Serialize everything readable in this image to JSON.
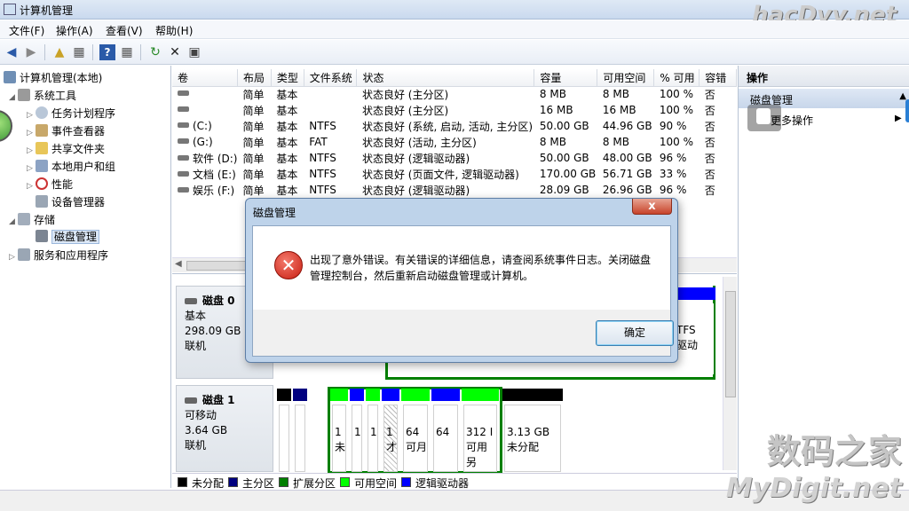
{
  "window": {
    "title": "计算机管理"
  },
  "menu": [
    "文件(F)",
    "操作(A)",
    "查看(V)",
    "帮助(H)"
  ],
  "tree": {
    "root": "计算机管理(本地)",
    "system_tools": "系统工具",
    "items": [
      "任务计划程序",
      "事件查看器",
      "共享文件夹",
      "本地用户和组",
      "性能",
      "设备管理器"
    ],
    "storage": "存储",
    "disk_management": "磁盘管理",
    "services": "服务和应用程序"
  },
  "volumes": {
    "headers": [
      "卷",
      "布局",
      "类型",
      "文件系统",
      "状态",
      "容量",
      "可用空间",
      "% 可用",
      "容错"
    ],
    "rows": [
      [
        "",
        "简单",
        "基本",
        "",
        "状态良好 (主分区)",
        "8 MB",
        "8 MB",
        "100 %",
        "否"
      ],
      [
        "",
        "简单",
        "基本",
        "",
        "状态良好 (主分区)",
        "16 MB",
        "16 MB",
        "100 %",
        "否"
      ],
      [
        "(C:)",
        "简单",
        "基本",
        "NTFS",
        "状态良好 (系统, 启动, 活动, 主分区)",
        "50.00 GB",
        "44.96 GB",
        "90 %",
        "否"
      ],
      [
        "(G:)",
        "简单",
        "基本",
        "FAT",
        "状态良好 (活动, 主分区)",
        "8 MB",
        "8 MB",
        "100 %",
        "否"
      ],
      [
        "软件 (D:)",
        "简单",
        "基本",
        "NTFS",
        "状态良好 (逻辑驱动器)",
        "50.00 GB",
        "48.00 GB",
        "96 %",
        "否"
      ],
      [
        "文档 (E:)",
        "简单",
        "基本",
        "NTFS",
        "状态良好 (页面文件, 逻辑驱动器)",
        "170.00 GB",
        "56.71 GB",
        "33 %",
        "否"
      ],
      [
        "娱乐 (F:)",
        "简单",
        "基本",
        "NTFS",
        "状态良好 (逻辑驱动器)",
        "28.09 GB",
        "26.96 GB",
        "96 %",
        "否"
      ]
    ]
  },
  "disk0": {
    "name": "磁盘 0",
    "type": "基本",
    "size": "298.09 GB",
    "status": "联机",
    "part_text1": "TFS",
    "part_text2": "驱动"
  },
  "disk1": {
    "name": "磁盘 1",
    "type": "可移动",
    "size": "3.64 GB",
    "status": "联机",
    "parts": [
      {
        "line1": "",
        "line2": ""
      },
      {
        "line1": "",
        "line2": ""
      },
      {
        "line1": "1",
        "line2": "未"
      },
      {
        "line1": "1",
        "line2": ""
      },
      {
        "line1": "1",
        "line2": ""
      },
      {
        "line1": "1",
        "line2": "才"
      },
      {
        "line1": "64",
        "line2": "可月"
      },
      {
        "line1": "64",
        "line2": ""
      },
      {
        "line1": "312 I",
        "line2": "可用另"
      },
      {
        "line1": "3.13 GB",
        "line2": "未分配"
      }
    ]
  },
  "legend": [
    "未分配",
    "主分区",
    "扩展分区",
    "可用空间",
    "逻辑驱动器"
  ],
  "colors": {
    "unallocated": "#000000",
    "primary": "#00007f",
    "extended": "#007f00",
    "free": "#00ff00",
    "logical": "#0000ff"
  },
  "actions": {
    "header": "操作",
    "section": "磁盘管理",
    "more": "更多操作"
  },
  "dialog": {
    "title": "磁盘管理",
    "message": "出现了意外错误。有关错误的详细信息，请查阅系统事件日志。关闭磁盘管理控制台，然后重新启动磁盘管理或计算机。",
    "ok": "确定",
    "close": "x"
  },
  "watermark": {
    "top": "hacDvy.net",
    "line1": "数码之家",
    "line2": "MyDigit.net"
  }
}
